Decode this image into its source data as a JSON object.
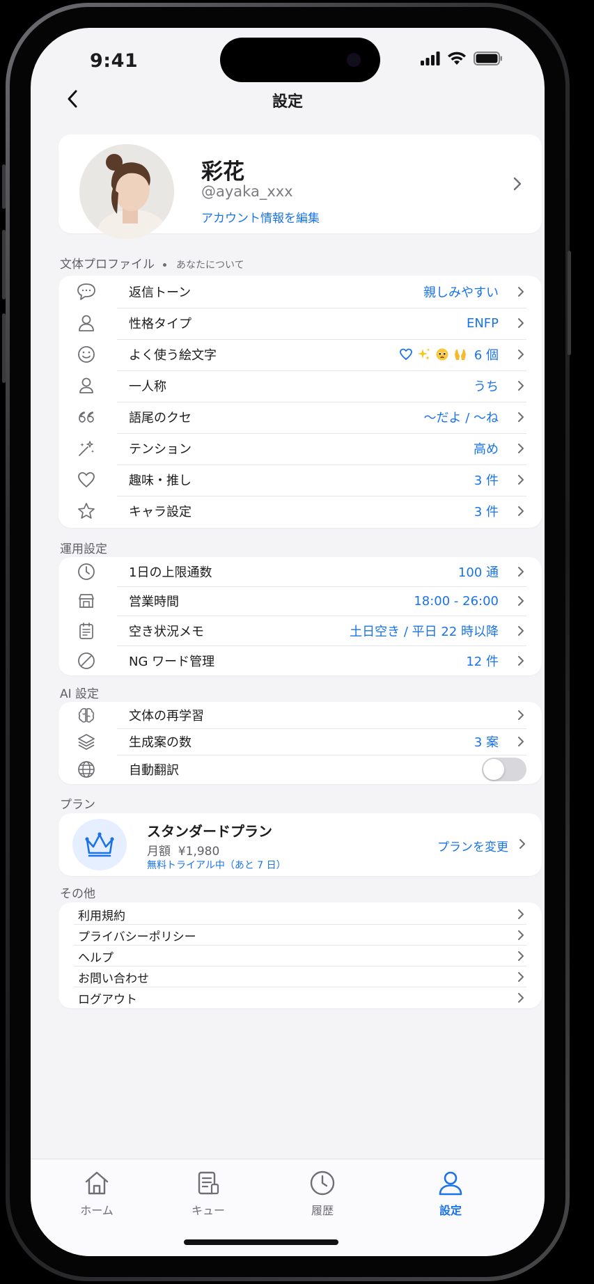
{
  "status": {
    "time": "9:41"
  },
  "nav": {
    "title": "設定"
  },
  "profile": {
    "name": "彩花",
    "handle": "@ayaka_xxx",
    "edit_label": "アカウント情報を編集"
  },
  "writing_profile": {
    "header": "文体プロファイル",
    "subheader": "あなたについて",
    "items": [
      {
        "icon": "chat-bubble-icon",
        "label": "返信トーン",
        "value": "親しみやすい"
      },
      {
        "icon": "person-icon",
        "label": "性格タイプ",
        "value": "ENFP"
      },
      {
        "icon": "smile-icon",
        "label": "よく使う絵文字",
        "emojis": [
          "heart-outline",
          "sparkles",
          "pleading-face",
          "raised-hands"
        ],
        "value": "6 個"
      },
      {
        "icon": "person-outline-icon",
        "label": "一人称",
        "value": "うち"
      },
      {
        "icon": "quote-icon",
        "label": "語尾のクセ",
        "value": "〜だよ / 〜ね"
      },
      {
        "icon": "sparkle-wand-icon",
        "label": "テンション",
        "value": "高め"
      },
      {
        "icon": "heart-icon",
        "label": "趣味・推し",
        "value": "3 件"
      },
      {
        "icon": "star-icon",
        "label": "キャラ設定",
        "value": "3 件"
      }
    ]
  },
  "operation": {
    "header": "運用設定",
    "items": [
      {
        "icon": "clock-icon",
        "label": "1日の上限通数",
        "value": "100 通"
      },
      {
        "icon": "shop-icon",
        "label": "営業時間",
        "value": "18:00 - 26:00"
      },
      {
        "icon": "calendar-note-icon",
        "label": "空き状況メモ",
        "value": "土日空き / 平日 22 時以降"
      },
      {
        "icon": "block-icon",
        "label": "NG ワード管理",
        "value": "12 件"
      }
    ]
  },
  "ai": {
    "header": "AI 設定",
    "items": [
      {
        "icon": "brain-icon",
        "label": "文体の再学習",
        "value": ""
      },
      {
        "icon": "layers-icon",
        "label": "生成案の数",
        "value": "3 案"
      },
      {
        "icon": "globe-icon",
        "label": "自動翻訳",
        "toggle": false
      }
    ]
  },
  "plan": {
    "header": "プラン",
    "name": "スタンダードプラン",
    "price": "月額  ¥1,980",
    "trial": "無料トライアル中（あと 7 日）",
    "change_label": "プランを変更"
  },
  "other": {
    "header": "その他",
    "items": [
      "利用規約",
      "プライバシーポリシー",
      "ヘルプ",
      "お問い合わせ",
      "ログアウト"
    ]
  },
  "tabs": [
    {
      "icon": "home-icon",
      "label": "ホーム",
      "active": false
    },
    {
      "icon": "queue-icon",
      "label": "キュー",
      "active": false
    },
    {
      "icon": "history-icon",
      "label": "履歴",
      "active": false
    },
    {
      "icon": "profile-icon",
      "label": "設定",
      "active": true
    }
  ],
  "colors": {
    "accent": "#1a73e8",
    "background": "#f4f4f6",
    "card": "#ffffff"
  }
}
